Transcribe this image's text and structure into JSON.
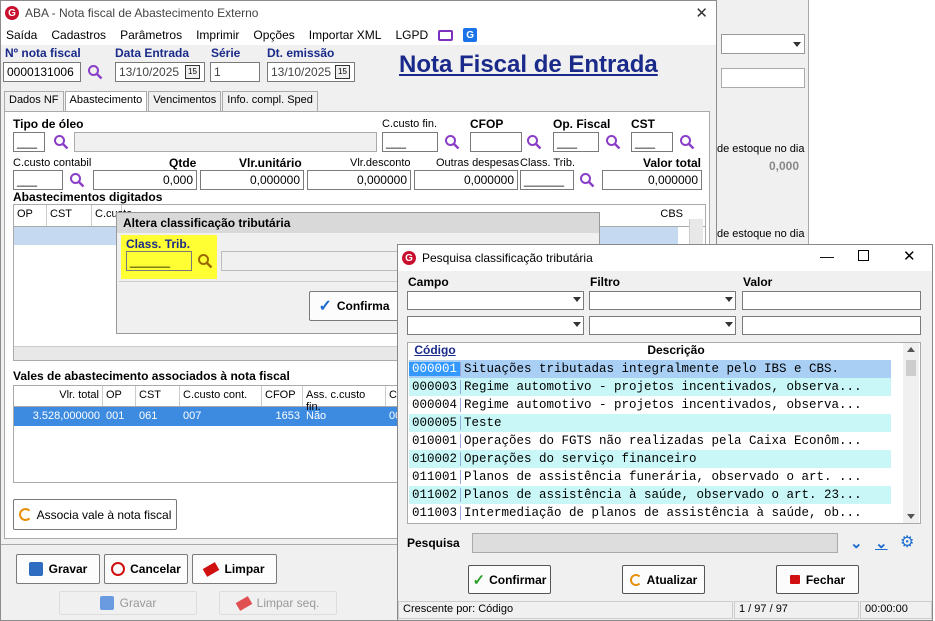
{
  "window": {
    "title": "ABA - Nota fiscal de Abastecimento Externo"
  },
  "menu": [
    "Saída",
    "Cadastros",
    "Parâmetros",
    "Imprimir",
    "Opções",
    "Importar XML",
    "LGPD"
  ],
  "header": {
    "nf_label": "Nº nota fiscal",
    "nf_value": "0000131006",
    "data_entrada_label": "Data Entrada",
    "data_entrada_value": "13/10/2025",
    "serie_label": "Série",
    "serie_value": "1",
    "dt_emissao_label": "Dt. emissão",
    "dt_emissao_value": "13/10/2025",
    "big_title": "Nota Fiscal de Entrada",
    "cal_icon": "15"
  },
  "tabs": [
    "Dados NF",
    "Abastecimento",
    "Vencimentos",
    "Info. compl. Sped"
  ],
  "abast": {
    "tipo_oleo": "Tipo de óleo",
    "ccusto_fin": "C.custo fin.",
    "cfop": "CFOP",
    "op_fiscal": "Op. Fiscal",
    "cst": "CST",
    "ccusto_cont": "C.custo contabil",
    "qtde": "Qtde",
    "qtde_value": "0,000",
    "vlr_unit": "Vlr.unitário",
    "vlr_unit_value": "0,000000",
    "vlr_desc": "Vlr.desconto",
    "vlr_desc_value": "0,000000",
    "outras": "Outras despesas",
    "outras_value": "0,000000",
    "class_trib": "Class. Trib.",
    "valor_total": "Valor total",
    "valor_total_value": "0,000000",
    "digitados_label": "Abastecimentos digitados",
    "grid_cols": [
      "OP",
      "CST",
      "C.custo",
      "CBS"
    ]
  },
  "vales": {
    "label": "Vales de abastecimento associados à nota fiscal",
    "cols": [
      "Vlr. total",
      "OP",
      "CST",
      "C.custo cont.",
      "CFOP",
      "Ass. c.custo fin.",
      "C"
    ],
    "row": [
      "3.528,000000",
      "001",
      "061",
      "007",
      "1653",
      "Não",
      "00"
    ],
    "assoc_button": "Associa vale à nota fiscal"
  },
  "footer": {
    "gravar": "Gravar",
    "cancelar": "Cancelar",
    "limpar": "Limpar",
    "gravar2": "Gravar",
    "limpar_seq": "Limpar seq."
  },
  "bg_window": {
    "text1": "de estoque no dia",
    "value1": "0,000",
    "text2": "de estoque no dia"
  },
  "altera": {
    "title": "Altera classificação tributária",
    "label": "Class. Trib.",
    "confirm": "Confirma"
  },
  "pesquisa": {
    "title": "Pesquisa classificação tributária",
    "campo": "Campo",
    "filtro": "Filtro",
    "valor": "Valor",
    "col_codigo": "Código",
    "col_descricao": "Descrição",
    "rows": [
      {
        "codigo": "000001",
        "descricao": "Situações tributadas integralmente pelo IBS e CBS."
      },
      {
        "codigo": "000003",
        "descricao": "Regime automotivo - projetos incentivados, observa..."
      },
      {
        "codigo": "000004",
        "descricao": "Regime automotivo - projetos incentivados, observa..."
      },
      {
        "codigo": "000005",
        "descricao": "Teste"
      },
      {
        "codigo": "010001",
        "descricao": "Operações do FGTS não realizadas pela Caixa Econôm..."
      },
      {
        "codigo": "010002",
        "descricao": "Operações do serviço financeiro"
      },
      {
        "codigo": "011001",
        "descricao": "Planos de assistência funerária, observado o art. ..."
      },
      {
        "codigo": "011002",
        "descricao": "Planos de assistência à saúde, observado o art. 23..."
      },
      {
        "codigo": "011003",
        "descricao": "Intermediação de planos de assistência à saúde, ob..."
      }
    ],
    "pesquisa_label": "Pesquisa",
    "confirmar": "Confirmar",
    "atualizar": "Atualizar",
    "fechar": "Fechar",
    "status_sort": "Crescente por: Código",
    "status_count": "1 / 97 / 97",
    "status_time": "00:00:00"
  },
  "colors": {
    "accent": "#1a2a8a",
    "highlight": "#ffff00",
    "row_alt": "#c9f7f7",
    "row_sel": "#3399ff"
  }
}
